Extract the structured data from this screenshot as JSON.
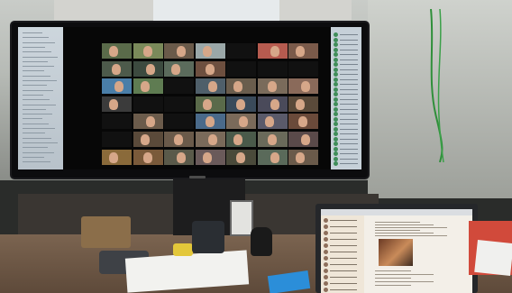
{
  "scene": {
    "description_free": true,
    "colors": {
      "desk": "#6b5644",
      "monitor_bezel": "#0c0c0e",
      "video_tile_background": "#3c4a3f",
      "participant_label_text": "#e8e8e8",
      "laptop_screen": "#f3efe8",
      "phone_case": "#2b8ed9",
      "cup": "#e3c73a"
    },
    "monitor": {
      "icon": "external-monitor-icon",
      "tiles": [
        {
          "col": 0,
          "row": 0,
          "tone": "#5a6b4a"
        },
        {
          "col": 1,
          "row": 0,
          "tone": "#7a8a5a"
        },
        {
          "col": 2,
          "row": 0,
          "tone": "#6a5a4a"
        },
        {
          "col": 3,
          "row": 0,
          "tone": "#9aa7a8"
        },
        {
          "col": 4,
          "row": 0,
          "tone": "#111111"
        },
        {
          "col": 5,
          "row": 0,
          "tone": "#b65b4f"
        },
        {
          "col": 6,
          "row": 0,
          "tone": "#7a5a4a"
        },
        {
          "col": 0,
          "row": 1,
          "tone": "#4d5a4b"
        },
        {
          "col": 1,
          "row": 1,
          "tone": "#3c4a3f"
        },
        {
          "col": 2,
          "row": 1,
          "tone": "#5b6b5c"
        },
        {
          "col": 3,
          "row": 1,
          "tone": "#6d4f3f"
        },
        {
          "col": 4,
          "row": 1,
          "tone": "#111111"
        },
        {
          "col": 5,
          "row": 1,
          "tone": "#111111"
        },
        {
          "col": 6,
          "row": 1,
          "tone": "#111111"
        },
        {
          "col": 0,
          "row": 2,
          "tone": "#4a7ea8"
        },
        {
          "col": 1,
          "row": 2,
          "tone": "#5f7c52"
        },
        {
          "col": 2,
          "row": 2,
          "tone": "#111111"
        },
        {
          "col": 3,
          "row": 2,
          "tone": "#4f5f6a"
        },
        {
          "col": 4,
          "row": 2,
          "tone": "#6a5d4d"
        },
        {
          "col": 5,
          "row": 2,
          "tone": "#7a6b5b"
        },
        {
          "col": 6,
          "row": 2,
          "tone": "#8a6a5a"
        },
        {
          "col": 0,
          "row": 3,
          "tone": "#3b3b3b"
        },
        {
          "col": 1,
          "row": 3,
          "tone": "#111111"
        },
        {
          "col": 2,
          "row": 3,
          "tone": "#111111"
        },
        {
          "col": 3,
          "row": 3,
          "tone": "#5a6a4a"
        },
        {
          "col": 4,
          "row": 3,
          "tone": "#3a4a5a"
        },
        {
          "col": 5,
          "row": 3,
          "tone": "#4a4a5a"
        },
        {
          "col": 6,
          "row": 3,
          "tone": "#5a4a3a"
        },
        {
          "col": 0,
          "row": 4,
          "tone": "#111111"
        },
        {
          "col": 1,
          "row": 4,
          "tone": "#6b5b4b"
        },
        {
          "col": 2,
          "row": 4,
          "tone": "#111111"
        },
        {
          "col": 3,
          "row": 4,
          "tone": "#4a6a8a"
        },
        {
          "col": 4,
          "row": 4,
          "tone": "#7a6a5a"
        },
        {
          "col": 5,
          "row": 4,
          "tone": "#5a5a6a"
        },
        {
          "col": 6,
          "row": 4,
          "tone": "#6a4a3a"
        },
        {
          "col": 0,
          "row": 5,
          "tone": "#111111"
        },
        {
          "col": 1,
          "row": 5,
          "tone": "#5a4a3a"
        },
        {
          "col": 2,
          "row": 5,
          "tone": "#6a5a4a"
        },
        {
          "col": 3,
          "row": 5,
          "tone": "#7a6a5a"
        },
        {
          "col": 4,
          "row": 5,
          "tone": "#4a5a4a"
        },
        {
          "col": 5,
          "row": 5,
          "tone": "#6a6a5a"
        },
        {
          "col": 6,
          "row": 5,
          "tone": "#5a4a4a"
        },
        {
          "col": 0,
          "row": 6,
          "tone": "#8a6a3a"
        },
        {
          "col": 1,
          "row": 6,
          "tone": "#7a5a3a"
        },
        {
          "col": 2,
          "row": 6,
          "tone": "#5a5a4a"
        },
        {
          "col": 3,
          "row": 6,
          "tone": "#6a5a5a"
        },
        {
          "col": 4,
          "row": 6,
          "tone": "#4a4a3a"
        },
        {
          "col": 5,
          "row": 6,
          "tone": "#5a6a5a"
        },
        {
          "col": 6,
          "row": 6,
          "tone": "#6a5a4a"
        }
      ]
    },
    "laptop": {
      "icon": "laptop-icon",
      "sidebar_rows": 12
    },
    "objects": {
      "speaker_icon": "speaker-icon",
      "phone_icon": "smartphone-icon",
      "cup_icon": "cup-icon",
      "basket_icon": "basket-icon"
    }
  }
}
